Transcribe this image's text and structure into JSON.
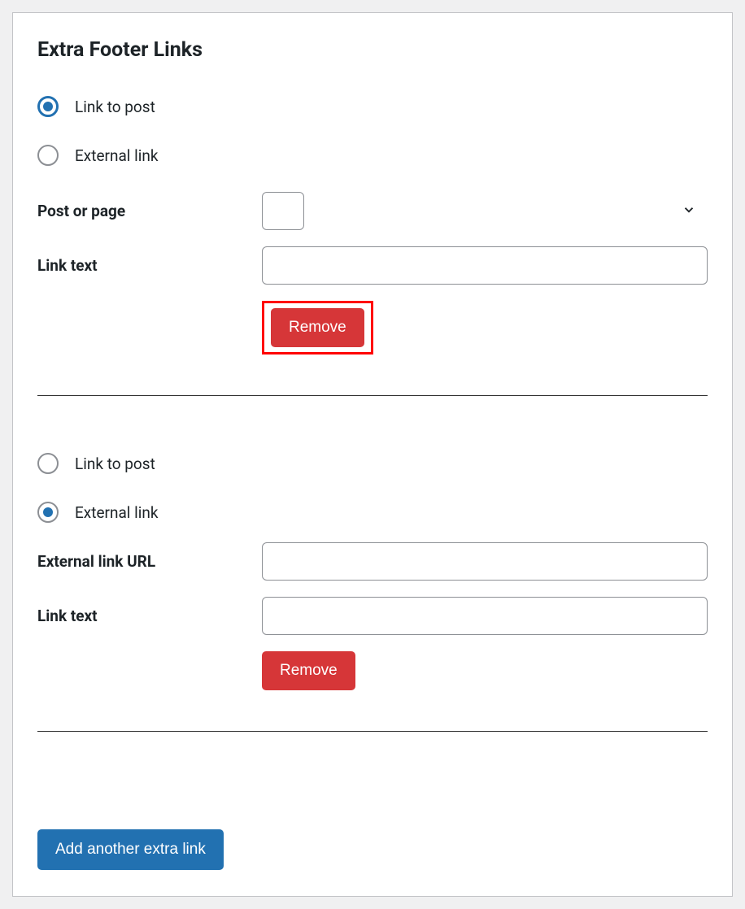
{
  "section": {
    "title": "Extra Footer Links"
  },
  "options": {
    "link_to_post": "Link to post",
    "external_link": "External link"
  },
  "labels": {
    "post_or_page": "Post or page",
    "link_text": "Link text",
    "external_link_url": "External link URL"
  },
  "buttons": {
    "remove": "Remove",
    "add_another": "Add another extra link"
  },
  "block1": {
    "post_or_page_value": "",
    "link_text_value": ""
  },
  "block2": {
    "external_url_value": "",
    "link_text_value": ""
  }
}
